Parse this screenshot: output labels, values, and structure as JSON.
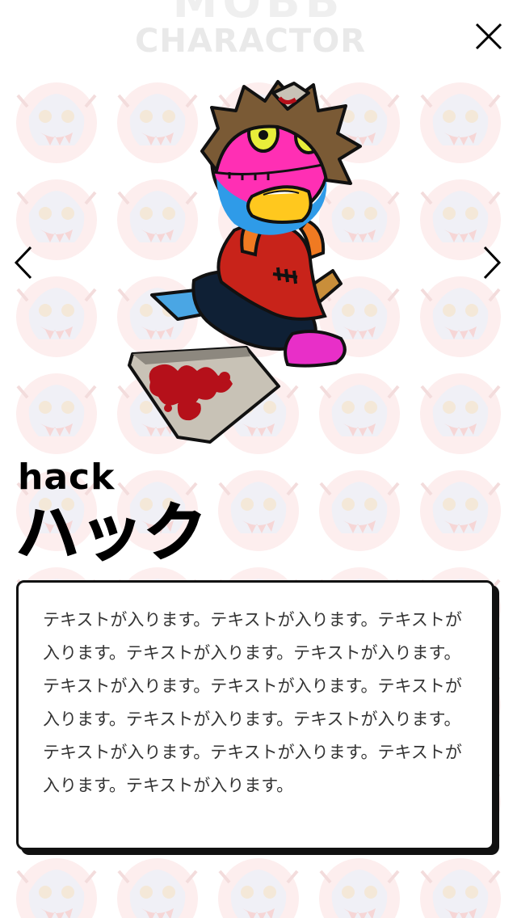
{
  "header": {
    "bg_top_text": "MOBB",
    "bg_title": "CHARACTOR"
  },
  "controls": {
    "close_icon": "close-icon",
    "prev_icon": "chevron-left-icon",
    "next_icon": "chevron-right-icon"
  },
  "character": {
    "name_en": "hack",
    "name_jp": "ハック",
    "description": "テキストが入ります。テキストが入ります。テキストが入ります。テキストが入ります。テキストが入ります。テキストが入ります。テキストが入ります。テキストが入ります。テキストが入ります。テキストが入ります。テキストが入ります。テキストが入ります。テキストが入ります。テキストが入ります。"
  },
  "colors": {
    "pattern_circle": "#fdeeee",
    "hair": "#7a5a35",
    "face_pink": "#ff2fb4",
    "face_blue": "#2f9be8",
    "shirt_red": "#c8231a",
    "pants_navy": "#0f2035",
    "shoe_pink": "#e82fc8",
    "knife_gray": "#bdb8ad",
    "blood": "#b5101a"
  }
}
